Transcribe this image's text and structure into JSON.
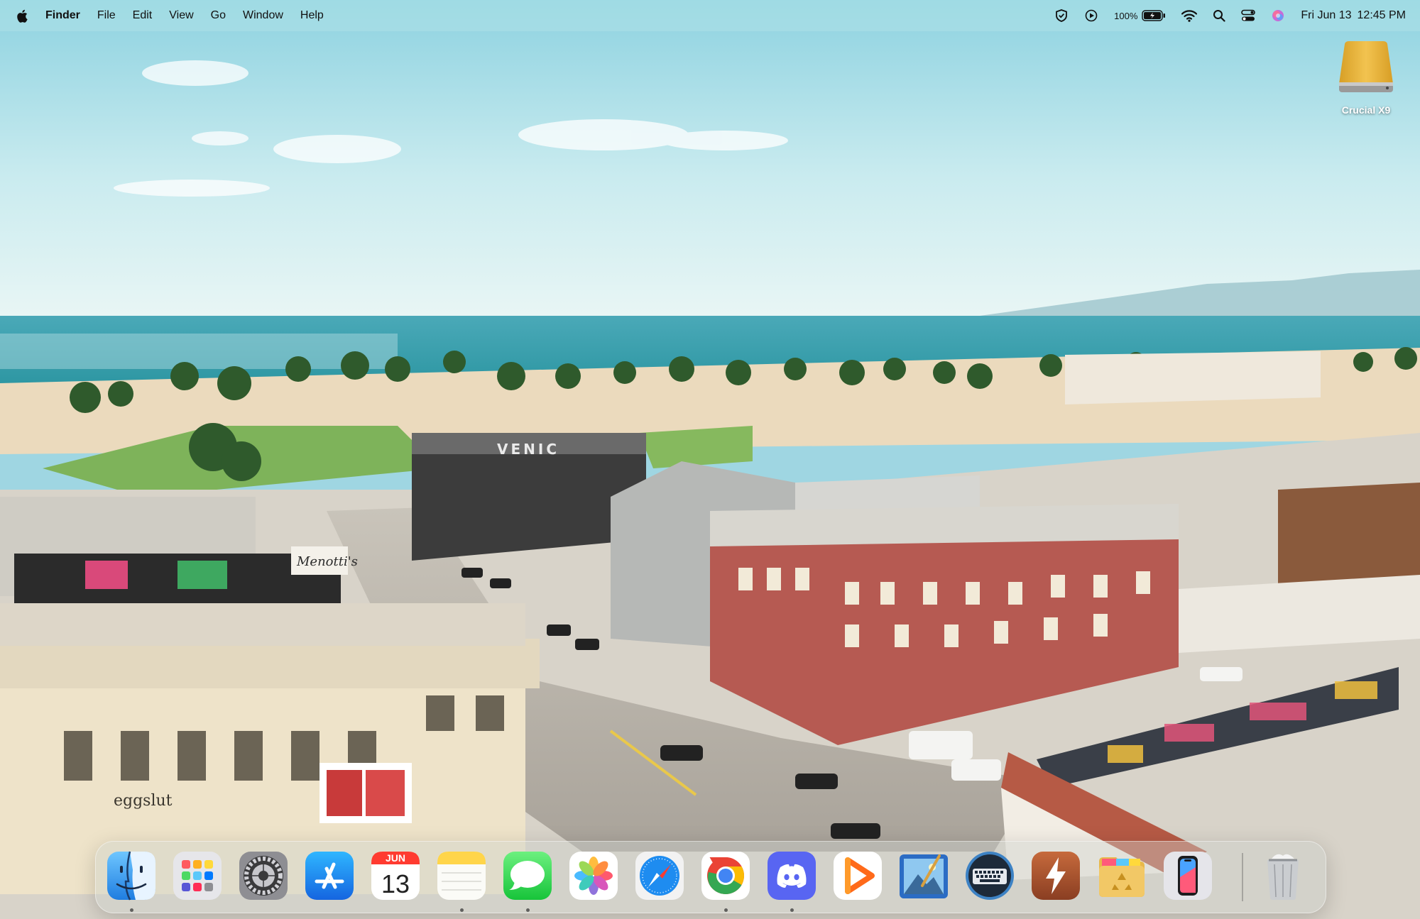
{
  "menubar": {
    "apple_icon": "apple-logo-icon",
    "app_name": "Finder",
    "menus": [
      "File",
      "Edit",
      "View",
      "Go",
      "Window",
      "Help"
    ],
    "status": {
      "battery_percent": "100%",
      "icons": [
        "shield-icon",
        "play-icon",
        "battery-icon",
        "wifi-icon",
        "search-icon",
        "control-center-icon",
        "siri-icon"
      ],
      "date": "Fri Jun 13",
      "time": "12:45 PM"
    }
  },
  "desktop": {
    "items": [
      {
        "label": "Crucial X9",
        "icon": "external-drive-icon"
      }
    ],
    "wallpaper_texts": [
      "VENIC",
      "Menotti's",
      "eggslut"
    ]
  },
  "calendar": {
    "month": "JUN",
    "day": "13"
  },
  "dock": {
    "apps": [
      {
        "name": "finder",
        "icon": "finder-icon",
        "running": true
      },
      {
        "name": "launchpad",
        "icon": "launchpad-icon",
        "running": false
      },
      {
        "name": "system-settings",
        "icon": "system-settings-icon",
        "running": false
      },
      {
        "name": "app-store",
        "icon": "app-store-icon",
        "running": false
      },
      {
        "name": "calendar",
        "icon": "calendar-icon",
        "running": false
      },
      {
        "name": "notes",
        "icon": "notes-icon",
        "running": true
      },
      {
        "name": "messages",
        "icon": "messages-icon",
        "running": true
      },
      {
        "name": "photos",
        "icon": "photos-icon",
        "running": false
      },
      {
        "name": "safari",
        "icon": "safari-icon",
        "running": false
      },
      {
        "name": "chrome",
        "icon": "chrome-icon",
        "running": true
      },
      {
        "name": "discord",
        "icon": "discord-icon",
        "running": true
      },
      {
        "name": "infuse",
        "icon": "infuse-play-icon",
        "running": false
      },
      {
        "name": "preview",
        "icon": "preview-icon",
        "running": false
      },
      {
        "name": "keyboard-utility",
        "icon": "keyboard-icon",
        "running": false
      },
      {
        "name": "reeder",
        "icon": "lightning-bolt-icon",
        "running": false
      },
      {
        "name": "archive-utility",
        "icon": "recycle-folder-icon",
        "running": false
      },
      {
        "name": "iphone-mirroring",
        "icon": "iphone-icon",
        "running": false
      },
      {
        "name": "trash",
        "icon": "trash-icon",
        "running": false
      }
    ]
  },
  "colors": {
    "menubar_bg": "#afe1e8",
    "sky_top": "#8fd3e2",
    "ocean": "#2a95a4",
    "sand": "#ecdcc0",
    "dock_bg": "#cdd2cd",
    "drive": "#e3b23c"
  }
}
